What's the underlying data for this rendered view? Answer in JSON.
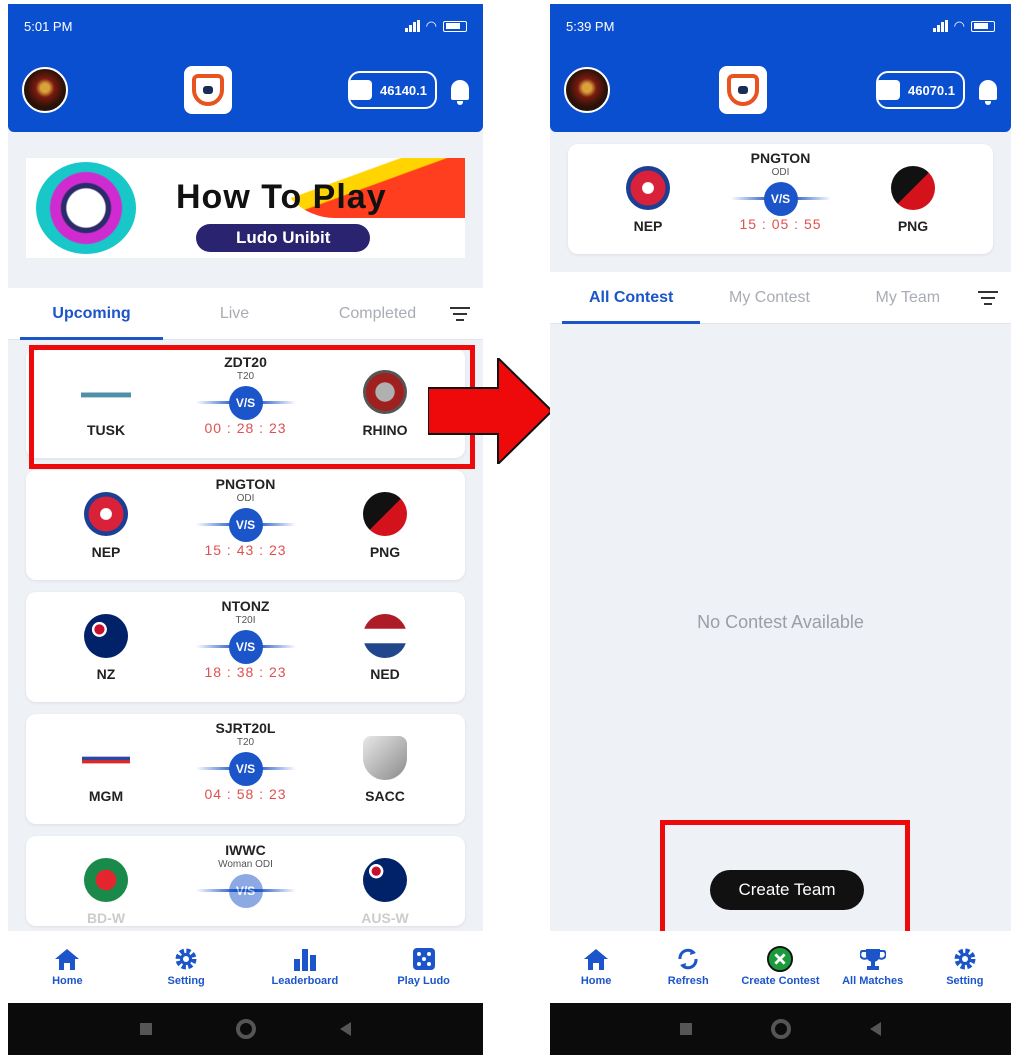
{
  "left": {
    "status_time": "5:01 PM",
    "wallet_balance": "46140.1",
    "banner": {
      "title": "How To Play",
      "subtitle": "Ludo Unibit"
    },
    "tabs": [
      {
        "label": "Upcoming"
      },
      {
        "label": "Live"
      },
      {
        "label": "Completed"
      }
    ],
    "matches": [
      {
        "name": "ZDT20",
        "type": "T20",
        "team1": "TUSK",
        "team2": "RHINO",
        "vs": "V/S",
        "timer": "00 : 28 : 23"
      },
      {
        "name": "PNGTON",
        "type": "ODI",
        "team1": "NEP",
        "team2": "PNG",
        "vs": "V/S",
        "timer": "15 : 43 : 23"
      },
      {
        "name": "NTONZ",
        "type": "T20I",
        "team1": "NZ",
        "team2": "NED",
        "vs": "V/S",
        "timer": "18 : 38 : 23"
      },
      {
        "name": "SJRT20L",
        "type": "T20",
        "team1": "MGM",
        "team2": "SACC",
        "vs": "V/S",
        "timer": "04 : 58 : 23"
      },
      {
        "name": "IWWC",
        "type": "Woman ODI",
        "team1": "BD-W",
        "team2": "AUS-W",
        "vs": "V/S",
        "timer": ""
      }
    ],
    "nav": [
      {
        "label": "Home",
        "icon": "home-icon"
      },
      {
        "label": "Setting",
        "icon": "gear-icon"
      },
      {
        "label": "Leaderboard",
        "icon": "bar-chart-icon"
      },
      {
        "label": "Play Ludo",
        "icon": "dice-icon"
      }
    ]
  },
  "right": {
    "status_time": "5:39 PM",
    "wallet_balance": "46070.1",
    "match": {
      "name": "PNGTON",
      "type": "ODI",
      "team1": "NEP",
      "team2": "PNG",
      "vs": "V/S",
      "timer": "15 : 05 : 55"
    },
    "tabs": [
      {
        "label": "All Contest"
      },
      {
        "label": "My Contest"
      },
      {
        "label": "My Team"
      }
    ],
    "empty_text": "No Contest Available",
    "create_team_label": "Create Team",
    "nav": [
      {
        "label": "Home",
        "icon": "home-icon"
      },
      {
        "label": "Refresh",
        "icon": "refresh-icon"
      },
      {
        "label": "Create Contest",
        "icon": "create-contest-icon"
      },
      {
        "label": "All Matches",
        "icon": "trophy-icon"
      },
      {
        "label": "Setting",
        "icon": "gear-icon"
      }
    ]
  },
  "colors": {
    "primary": "#0b4fd1",
    "highlight": "#ee0a0a",
    "timer": "#e05050"
  }
}
